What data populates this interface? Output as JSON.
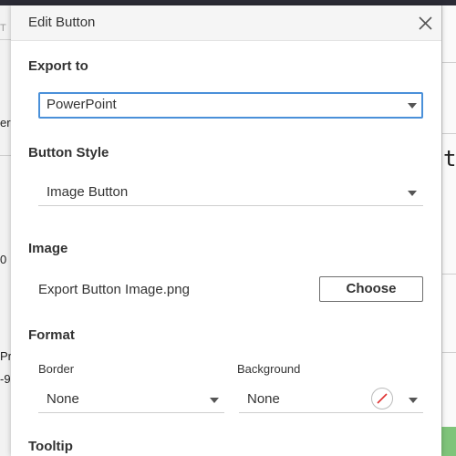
{
  "dialog": {
    "title": "Edit Button",
    "export_to": {
      "label": "Export to",
      "value": "PowerPoint"
    },
    "button_style": {
      "label": "Button Style",
      "value": "Image Button"
    },
    "image": {
      "label": "Image",
      "filename": "Export Button Image.png",
      "choose_label": "Choose"
    },
    "format": {
      "label": "Format",
      "border": {
        "label": "Border",
        "value": "None"
      },
      "background": {
        "label": "Background",
        "value": "None"
      }
    },
    "tooltip": {
      "label": "Tooltip"
    }
  },
  "background_fragments": {
    "left": [
      "T",
      "er",
      "0",
      "Pr",
      "-9"
    ],
    "right": "t"
  },
  "colors": {
    "focus_border": "#4a90d9",
    "no_color_slash": "#e03030",
    "top_bar": "#2b2b35",
    "right_accent": "#7fc47a"
  },
  "icons": {
    "close": "close-icon",
    "dropdown": "caret-down-icon",
    "no_color": "no-color-icon"
  }
}
